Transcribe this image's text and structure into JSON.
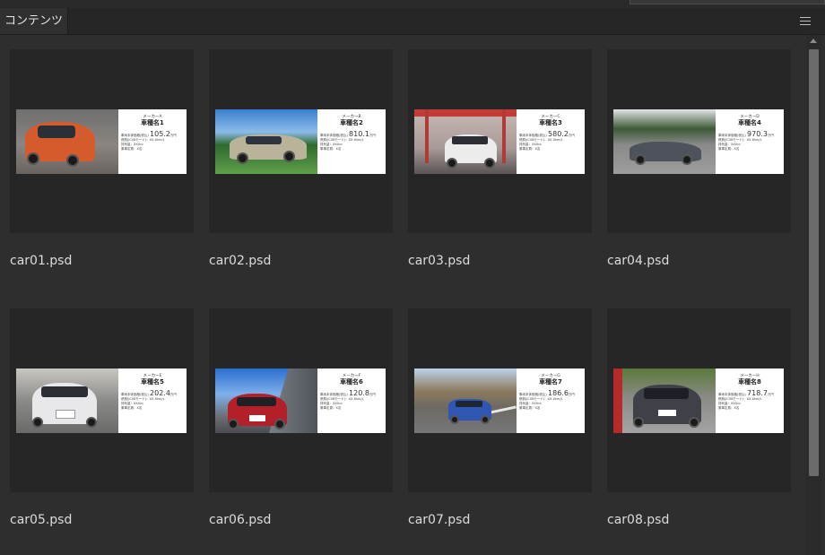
{
  "panel": {
    "tab_label": "コンテンツ",
    "menu_icon": "hamburger-menu-icon"
  },
  "items": [
    {
      "filename": "car01.psd",
      "card": {
        "maker": "メーカーA",
        "model": "車種名1",
        "price_label": "車両本体価格(税込)",
        "price": "105.2",
        "price_unit": "万円",
        "line2": "燃費(JC08モード)：XX.Xkm/L",
        "line3": "排気量：XXXcc",
        "line4": "乗車定員：X名"
      }
    },
    {
      "filename": "car02.psd",
      "card": {
        "maker": "メーカーB",
        "model": "車種名2",
        "price_label": "車両本体価格(税込)",
        "price": "810.1",
        "price_unit": "万円",
        "line2": "燃費(JC08モード)：XX.Xkm/L",
        "line3": "排気量：XXXcc",
        "line4": "乗車定員：X名"
      }
    },
    {
      "filename": "car03.psd",
      "card": {
        "maker": "メーカーC",
        "model": "車種名3",
        "price_label": "車両本体価格(税込)",
        "price": "580.2",
        "price_unit": "万円",
        "line2": "燃費(JC08モード)：XX.Xkm/L",
        "line3": "排気量：XXXcc",
        "line4": "乗車定員：X名"
      }
    },
    {
      "filename": "car04.psd",
      "card": {
        "maker": "メーカーD",
        "model": "車種名4",
        "price_label": "車両本体価格(税込)",
        "price": "970.3",
        "price_unit": "万円",
        "line2": "燃費(JC08モード)：XX.Xkm/L",
        "line3": "排気量：XXXcc",
        "line4": "乗車定員：X名"
      }
    },
    {
      "filename": "car05.psd",
      "card": {
        "maker": "メーカーE",
        "model": "車種名5",
        "price_label": "車両本体価格(税込)",
        "price": "202.4",
        "price_unit": "万円",
        "line2": "燃費(JC08モード)：XX.Xkm/L",
        "line3": "排気量：XXXcc",
        "line4": "乗車定員：X名"
      }
    },
    {
      "filename": "car06.psd",
      "card": {
        "maker": "メーカーF",
        "model": "車種名6",
        "price_label": "車両本体価格(税込)",
        "price": "120.8",
        "price_unit": "万円",
        "line2": "燃費(JC08モード)：XX.Xkm/L",
        "line3": "排気量：XXXcc",
        "line4": "乗車定員：X名"
      }
    },
    {
      "filename": "car07.psd",
      "card": {
        "maker": "メーカーG",
        "model": "車種名7",
        "price_label": "車両本体価格(税込)",
        "price": "186.6",
        "price_unit": "万円",
        "line2": "燃費(JC08モード)：XX.Xkm/L",
        "line3": "排気量：XXXcc",
        "line4": "乗車定員：X名"
      }
    },
    {
      "filename": "car08.psd",
      "card": {
        "maker": "メーカーH",
        "model": "車種名8",
        "price_label": "車両本体価格(税込)",
        "price": "718.7",
        "price_unit": "万円",
        "line2": "燃費(JC08モード)：XX.Xkm/L",
        "line3": "排気量：XXXcc",
        "line4": "乗車定員：X名"
      }
    }
  ],
  "colors": {
    "panel_bg": "#2e2e2e",
    "thumb_bg": "#262626",
    "text": "#dcdcdc"
  }
}
